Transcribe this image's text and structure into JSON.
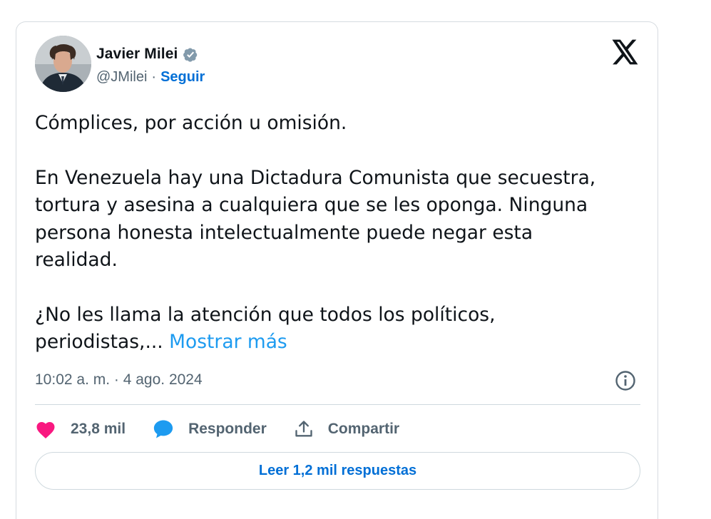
{
  "author": {
    "name": "Javier Milei",
    "handle": "@JMilei",
    "separator": "·",
    "follow_label": "Seguir",
    "verified_icon": "verified-badge-icon"
  },
  "brand": {
    "logo_icon": "x-logo-icon"
  },
  "tweet": {
    "paragraph_1": "Cómplices, por acción u omisión.",
    "paragraph_2_line_1": "En Venezuela hay una Dictadura Comunista que secuestra,",
    "paragraph_2_line_2": "tortura y asesina a cualquiera que se les oponga. Ninguna",
    "paragraph_2_line_3": "persona honesta intelectualmente puede negar esta",
    "paragraph_2_line_4": "realidad.",
    "paragraph_3_line_1": "¿No les llama la atención que todos los políticos,",
    "paragraph_3_line_2": "periodistas,...",
    "show_more_label": "Mostrar más"
  },
  "meta": {
    "timestamp": "10:02 a. m. · 4 ago. 2024",
    "info_icon": "info-icon"
  },
  "actions": {
    "likes_count": "23,8 mil",
    "reply_label": "Responder",
    "share_label": "Compartir"
  },
  "replies": {
    "button_label": "Leer 1,2 mil respuestas"
  },
  "colors": {
    "accent": "#1d9bf0",
    "link_strong": "#006fd6",
    "like": "#f91880",
    "muted": "#536471",
    "text": "#0f1419",
    "border": "#cfd9de"
  }
}
